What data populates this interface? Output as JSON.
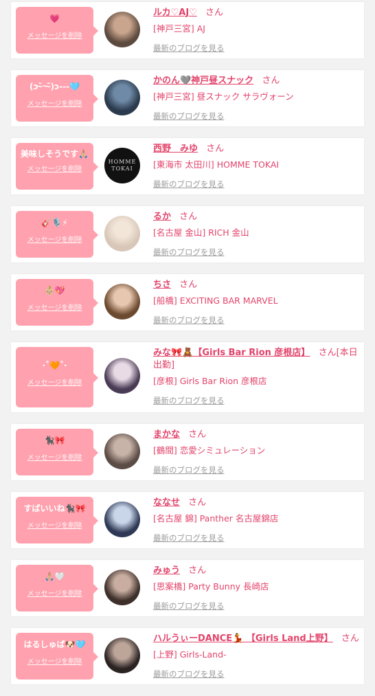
{
  "cards": [
    {
      "message": "💗",
      "delete_label": "メッセージを削除",
      "name": "ルカ♡AJ♡",
      "honorific": "さん",
      "shop": "[神戸三宮] AJ",
      "blog_link": "最新のブログを見る",
      "avatar_colors": [
        "#5d4a3e",
        "#c9a58e"
      ]
    },
    {
      "message": "(ɔ˘̴̀ᵕ˘̴́)ɔ---🩵",
      "delete_label": "メッセージを削除",
      "name": "かのん🩶神戸昼スナック",
      "honorific": "さん",
      "shop": "[神戸三宮] 昼スナック サラヴォーン",
      "blog_link": "最新のブログを見る",
      "avatar_colors": [
        "#2b3a4d",
        "#6f8aa6"
      ]
    },
    {
      "message": "美味しそうです🙏🏼",
      "delete_label": "メッセージを削除",
      "name": "西野　みゆ",
      "honorific": "さん",
      "shop": "[東海市 太田川] HOMME TOKAI",
      "blog_link": "最新のブログを見る",
      "avatar_colors": [
        "#111111",
        "#555555"
      ],
      "avatar_text": "HOMME TOKAI"
    },
    {
      "message": "🎸🎙️⚡",
      "delete_label": "メッセージを削除",
      "name": "るか",
      "honorific": "さん",
      "shop": "[名古屋 金山] RICH 金山",
      "blog_link": "最新のブログを見る",
      "avatar_colors": [
        "#d8c7b8",
        "#f2e6d9"
      ]
    },
    {
      "message": "👶🏼💖",
      "delete_label": "メッセージを削除",
      "name": "ちさ",
      "honorific": "さん",
      "shop": "[船橋] EXCITING BAR MARVEL",
      "blog_link": "最新のブログを見る",
      "avatar_colors": [
        "#6b4a2f",
        "#e8c7b0"
      ]
    },
    {
      "message": "·˚🧡˚·",
      "delete_label": "メッセージを削除",
      "name": "みな🎀🧸【Girls Bar Rion 彦根店】",
      "honorific": "さん[本日出勤]",
      "shop": "[彦根] Girls Bar Rion 彦根店",
      "blog_link": "最新のブログを見る",
      "avatar_colors": [
        "#4a3b55",
        "#e9dbe6"
      ]
    },
    {
      "message": "🐈‍⬛🎀",
      "delete_label": "メッセージを削除",
      "name": "まかな",
      "honorific": "さん",
      "shop": "[鶴間] 恋愛シミュレーション",
      "blog_link": "最新のブログを見る",
      "avatar_colors": [
        "#5c4c46",
        "#c7b3a8"
      ]
    },
    {
      "message": "すばいいね🐈‍⬛🎀",
      "delete_label": "メッセージを削除",
      "name": "ななせ",
      "honorific": "さん",
      "shop": "[名古屋 錦] Panther 名古屋錦店",
      "blog_link": "最新のブログを見る",
      "avatar_colors": [
        "#2e3a55",
        "#c9d6ea"
      ]
    },
    {
      "message": "🙏🏼🤍",
      "delete_label": "メッセージを削除",
      "name": "みゅう",
      "honorific": "さん",
      "shop": "[思案橋] Party Bunny 長崎店",
      "blog_link": "最新のブログを見る",
      "avatar_colors": [
        "#3d2f2a",
        "#c8ada0"
      ]
    },
    {
      "message": "はるしゅば🐶🩵",
      "delete_label": "メッセージを削除",
      "name": "ハルうぃーDANCE💃 【Girls Land上野】",
      "honorific": "さん",
      "shop": "[上野] Girls-Land-",
      "blog_link": "最新のブログを見る",
      "avatar_colors": [
        "#2a2322",
        "#bda59a"
      ]
    }
  ]
}
